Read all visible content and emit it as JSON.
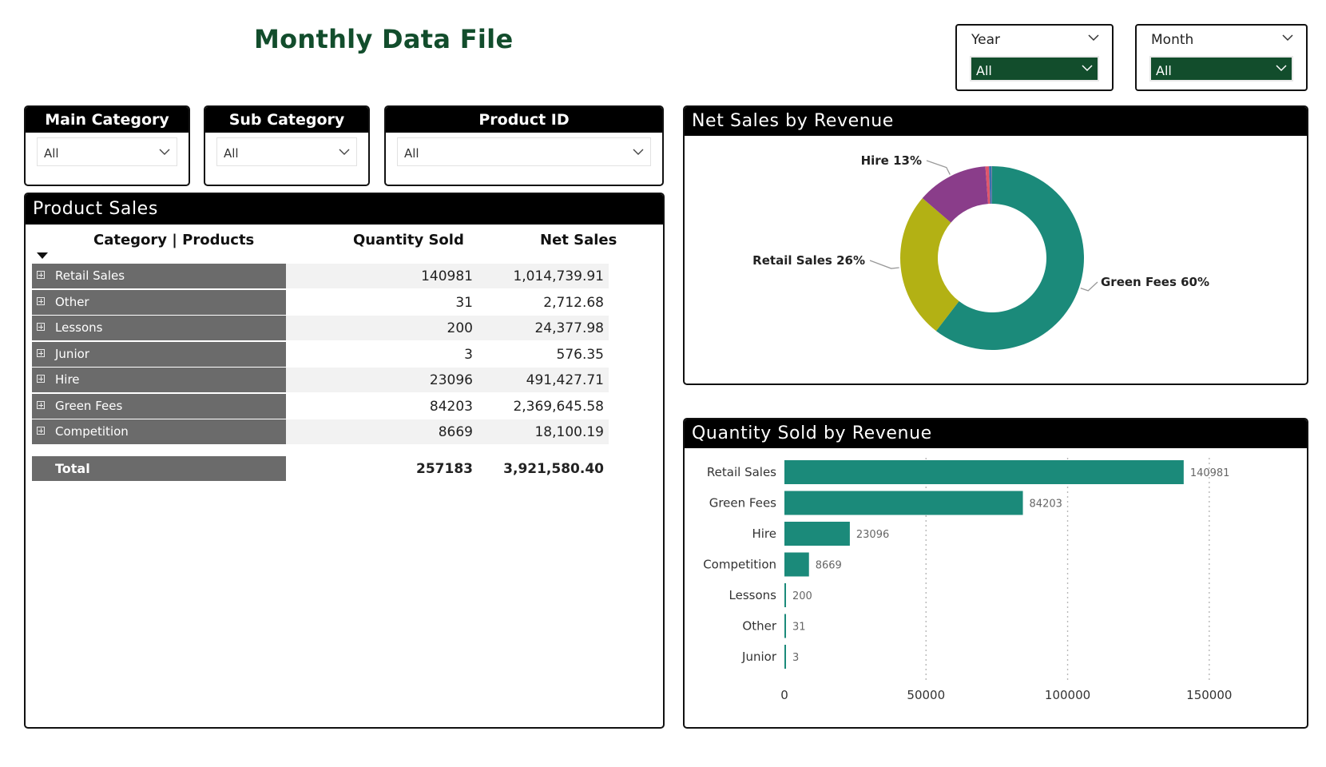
{
  "page": {
    "title": "Monthly Data File"
  },
  "top_filters": [
    {
      "label": "Year",
      "value": "All"
    },
    {
      "label": "Month",
      "value": "All"
    }
  ],
  "filters": [
    {
      "label": "Main Category",
      "value": "All"
    },
    {
      "label": "Sub Category",
      "value": "All"
    },
    {
      "label": "Product ID",
      "value": "All"
    }
  ],
  "product_sales": {
    "title": "Product Sales",
    "columns": [
      "Category | Products",
      "Quantity Sold",
      "Net Sales"
    ],
    "rows": [
      {
        "category": "Retail Sales",
        "quantity": "140981",
        "net_sales": "1,014,739.91"
      },
      {
        "category": "Other",
        "quantity": "31",
        "net_sales": "2,712.68"
      },
      {
        "category": "Lessons",
        "quantity": "200",
        "net_sales": "24,377.98"
      },
      {
        "category": "Junior",
        "quantity": "3",
        "net_sales": "576.35"
      },
      {
        "category": "Hire",
        "quantity": "23096",
        "net_sales": "491,427.71"
      },
      {
        "category": "Green Fees",
        "quantity": "84203",
        "net_sales": "2,369,645.58"
      },
      {
        "category": "Competition",
        "quantity": "8669",
        "net_sales": "18,100.19"
      }
    ],
    "total": {
      "label": "Total",
      "quantity": "257183",
      "net_sales": "3,921,580.40"
    }
  },
  "chart_data": [
    {
      "type": "pie",
      "title": "Net Sales by Revenue",
      "donut": true,
      "categories": [
        "Green Fees",
        "Retail Sales",
        "Hire",
        "Lessons",
        "Competition",
        "Other",
        "Junior"
      ],
      "values": [
        2369645.58,
        1014739.91,
        491427.71,
        24377.98,
        18100.19,
        2712.68,
        576.35
      ],
      "colors": [
        "#1b8a7a",
        "#b3b114",
        "#8a3d8a",
        "#e0566a",
        "#3a6fb0",
        "#7a7a7a",
        "#999999"
      ],
      "labels": [
        {
          "category": "Green Fees",
          "text": "Green Fees 60%"
        },
        {
          "category": "Retail Sales",
          "text": "Retail Sales 26%"
        },
        {
          "category": "Hire",
          "text": "Hire 13%"
        }
      ]
    },
    {
      "type": "bar",
      "orientation": "horizontal",
      "title": "Quantity Sold by Revenue",
      "categories": [
        "Retail Sales",
        "Green Fees",
        "Hire",
        "Competition",
        "Lessons",
        "Other",
        "Junior"
      ],
      "values": [
        140981,
        84203,
        23096,
        8669,
        200,
        31,
        3
      ],
      "xlim": [
        0,
        165000
      ],
      "xticks": [
        0,
        50000,
        100000,
        150000
      ],
      "grid": true,
      "color": "#1b8a7a"
    }
  ]
}
